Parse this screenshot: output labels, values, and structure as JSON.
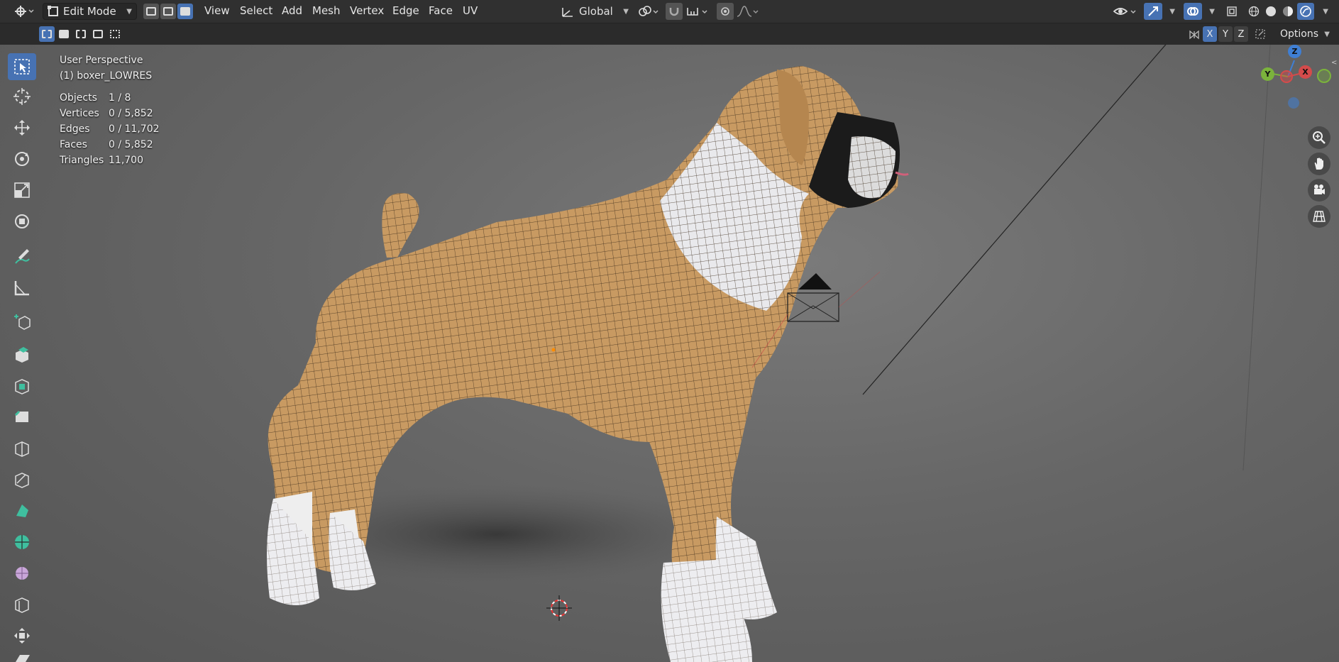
{
  "header": {
    "mode": "Edit Mode",
    "menus": [
      "View",
      "Select",
      "Add",
      "Mesh",
      "Vertex",
      "Edge",
      "Face",
      "UV"
    ],
    "orientation": "Global",
    "options_label": "Options"
  },
  "axes_toggle": [
    "X",
    "Y",
    "Z"
  ],
  "viewport": {
    "perspective": "User Perspective",
    "object_name": "(1) boxer_LOWRES",
    "stats": [
      {
        "label": "Objects",
        "value": "1 / 8"
      },
      {
        "label": "Vertices",
        "value": "0 / 5,852"
      },
      {
        "label": "Edges",
        "value": "0 / 11,702"
      },
      {
        "label": "Faces",
        "value": "0 / 5,852"
      },
      {
        "label": "Triangles",
        "value": "11,700"
      }
    ]
  },
  "gizmo": {
    "z": "Z",
    "y": "Y",
    "x": "X"
  },
  "tools": [
    "select-box-icon",
    "cursor-icon",
    "move-icon",
    "rotate-icon",
    "scale-icon",
    "transform-icon",
    "annotate-icon",
    "measure-icon",
    "add-cube-icon",
    "extrude-icon",
    "inset-icon",
    "bevel-icon",
    "loop-cut-icon",
    "knife-icon",
    "poly-build-icon",
    "spin-icon",
    "smooth-icon",
    "edge-slide-icon",
    "shrink-fatten-icon",
    "shear-icon"
  ],
  "colors": {
    "accent": "#4772b3",
    "x_axis": "#d44b4b",
    "y_axis": "#7bb33c",
    "z_axis": "#3f7fd4"
  }
}
